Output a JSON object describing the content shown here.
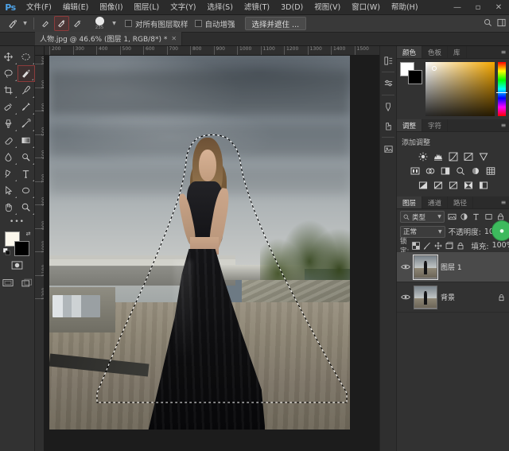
{
  "app": {
    "name": "Ps",
    "logo_color": "#4ea3e8"
  },
  "menubar": {
    "items": [
      {
        "label": "文件(F)"
      },
      {
        "label": "编辑(E)"
      },
      {
        "label": "图像(I)"
      },
      {
        "label": "图层(L)"
      },
      {
        "label": "文字(Y)"
      },
      {
        "label": "选择(S)"
      },
      {
        "label": "滤镜(T)"
      },
      {
        "label": "3D(D)"
      },
      {
        "label": "视图(V)"
      },
      {
        "label": "窗口(W)"
      },
      {
        "label": "帮助(H)"
      }
    ],
    "window_controls": {
      "minimize": "—",
      "maximize": "▫",
      "close": "✕"
    }
  },
  "options_bar": {
    "tool_preset_name": "quick-selection-tool",
    "mode_new": "new-selection",
    "mode_add": "add-to-selection",
    "mode_subtract": "subtract-from-selection",
    "brush_size": "235",
    "sample_all_layers_label": "对所有图层取样",
    "auto_enhance_label": "自动增强",
    "select_and_mask_label": "选择并遮住 ..."
  },
  "document_tab": {
    "title": "人物.jpg @ 46.6% (图层 1, RGB/8*) *",
    "close": "✕"
  },
  "toolbar": {
    "tools": [
      {
        "name": "move-tool",
        "label": "移动工具"
      },
      {
        "name": "marquee-tool",
        "label": "选框工具"
      },
      {
        "name": "lasso-tool",
        "label": "套索工具"
      },
      {
        "name": "quick-selection-tool",
        "label": "快速选择工具",
        "selected": true
      },
      {
        "name": "crop-tool",
        "label": "裁剪工具"
      },
      {
        "name": "eyedropper-tool",
        "label": "吸管工具"
      },
      {
        "name": "healing-brush-tool",
        "label": "污点修复画笔工具"
      },
      {
        "name": "brush-tool",
        "label": "画笔工具"
      },
      {
        "name": "clone-stamp-tool",
        "label": "仿制图章工具"
      },
      {
        "name": "history-brush-tool",
        "label": "历史记录画笔工具"
      },
      {
        "name": "eraser-tool",
        "label": "橡皮擦工具"
      },
      {
        "name": "gradient-tool",
        "label": "渐变工具"
      },
      {
        "name": "blur-tool",
        "label": "模糊工具"
      },
      {
        "name": "dodge-tool",
        "label": "减淡工具"
      },
      {
        "name": "pen-tool",
        "label": "钢笔工具"
      },
      {
        "name": "type-tool",
        "label": "文字工具"
      },
      {
        "name": "path-selection-tool",
        "label": "路径选择工具"
      },
      {
        "name": "shape-tool",
        "label": "形状工具"
      },
      {
        "name": "hand-tool",
        "label": "抓手工具"
      },
      {
        "name": "zoom-tool",
        "label": "缩放工具"
      }
    ],
    "more_tools": "•••",
    "foreground_color": "#fbf7ec",
    "background_color": "#000000",
    "quick_mask_label": "以快速蒙版模式编辑",
    "screen_mode_label": "更改屏幕模式"
  },
  "rulers": {
    "horizontal_ticks": [
      "200",
      "300",
      "400",
      "500",
      "600",
      "700",
      "800",
      "900",
      "1000",
      "1100",
      "1200",
      "1300",
      "1400",
      "1500"
    ],
    "vertical_ticks": [
      "200",
      "300",
      "400",
      "500",
      "600",
      "700",
      "800",
      "900",
      "1000",
      "1100",
      "1200"
    ],
    "unit": "像素"
  },
  "canvas": {
    "zoom": "46.6%",
    "selection_active": true,
    "image_description": "riverside-portrait"
  },
  "right_dock": {
    "strip_icons": [
      {
        "name": "history-panel-icon"
      },
      {
        "name": "properties-panel-icon"
      },
      {
        "name": "brush-settings-panel-icon"
      },
      {
        "name": "clone-source-panel-icon"
      },
      {
        "name": "libraries-panel-icon"
      }
    ],
    "color_panel": {
      "tabs": [
        {
          "label": "颜色",
          "active": true
        },
        {
          "label": "色板",
          "active": false
        },
        {
          "label": "库",
          "active": false
        }
      ],
      "menu": "≡",
      "foreground": "#ffffff",
      "background": "#000000",
      "field_accent": "#f5a800"
    },
    "adjustments_panel": {
      "tabs": [
        {
          "label": "调整",
          "active": true
        },
        {
          "label": "字符",
          "active": false
        }
      ],
      "menu": "≡",
      "title": "添加调整",
      "rows": [
        [
          "brightness-contrast-icon",
          "levels-icon",
          "curves-icon",
          "exposure-icon",
          "vibrance-icon"
        ],
        [
          "hue-saturation-icon",
          "color-balance-icon",
          "black-white-icon",
          "photo-filter-icon",
          "channel-mixer-icon",
          "color-lookup-icon"
        ],
        [
          "invert-icon",
          "posterize-icon",
          "threshold-icon",
          "gradient-map-icon",
          "selective-color-icon"
        ]
      ]
    },
    "layers_panel": {
      "tabs": [
        {
          "label": "图层",
          "active": true
        },
        {
          "label": "通道",
          "active": false
        },
        {
          "label": "路径",
          "active": false
        }
      ],
      "menu": "≡",
      "filter_label": "类型",
      "filter_icons": [
        "pixel-filter-icon",
        "adjustment-filter-icon",
        "type-filter-icon",
        "shape-filter-icon",
        "smart-object-filter-icon"
      ],
      "blend_mode": "正常",
      "opacity_label": "不透明度:",
      "opacity_value": "100%",
      "lock_label": "锁定:",
      "lock_icons": [
        "lock-transparent-pixels-icon",
        "lock-image-pixels-icon",
        "lock-position-icon",
        "lock-artboard-icon",
        "lock-all-icon"
      ],
      "fill_label": "填充:",
      "fill_value": "100%",
      "layers": [
        {
          "name": "图层 1",
          "visible": true,
          "selected": true,
          "locked": false
        },
        {
          "name": "背景",
          "visible": true,
          "selected": false,
          "locked": true
        }
      ]
    },
    "badge": {
      "name": "status-badge",
      "text": "●"
    }
  }
}
